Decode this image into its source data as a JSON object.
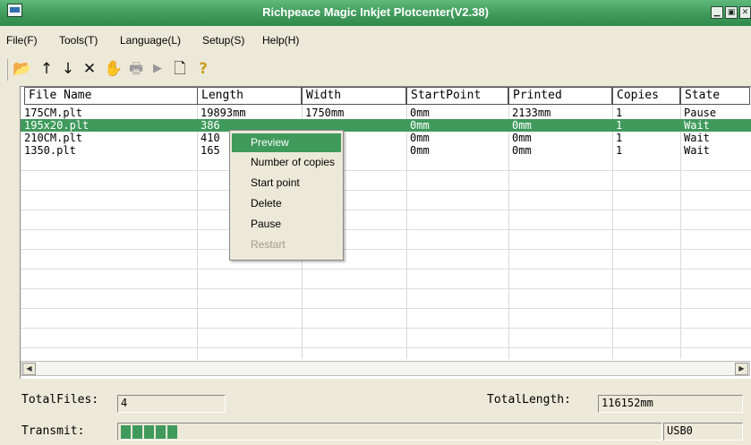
{
  "window": {
    "title": "Richpeace Magic Inkjet Plotcenter(V2.38)",
    "controls": {
      "minimize": "▁",
      "maximize": "▣",
      "close": "✕"
    }
  },
  "menu": [
    {
      "label": "File(F)"
    },
    {
      "label": "Tools(T)"
    },
    {
      "label": "Language(L)"
    },
    {
      "label": "Setup(S)"
    },
    {
      "label": "Help(H)"
    }
  ],
  "toolbar": [
    {
      "icon": "open-folder-icon",
      "glyph": "📂"
    },
    {
      "icon": "move-up-icon",
      "glyph": "↑"
    },
    {
      "icon": "move-down-icon",
      "glyph": "↓"
    },
    {
      "icon": "delete-icon",
      "glyph": "✕"
    },
    {
      "icon": "hand-icon",
      "glyph": "✋"
    },
    {
      "icon": "printer-icon",
      "glyph": "🖶"
    },
    {
      "icon": "play-icon",
      "glyph": "▶"
    },
    {
      "icon": "print-preview-icon",
      "glyph": "🗋"
    },
    {
      "icon": "help-icon",
      "glyph": "?"
    }
  ],
  "table": {
    "columns": [
      "File Name",
      "Length",
      "Width",
      "StartPoint",
      "Printed",
      "Copies",
      "State"
    ],
    "rows": [
      [
        "175CM.plt",
        "19893mm",
        "1750mm",
        "0mm",
        "2133mm",
        "1",
        "Pause"
      ],
      [
        "195x20.plt",
        "386",
        "",
        "0mm",
        "0mm",
        "1",
        "Wait"
      ],
      [
        "210CM.plt",
        "410",
        "",
        "0mm",
        "0mm",
        "1",
        "Wait"
      ],
      [
        "1350.plt",
        "165",
        "",
        "0mm",
        "0mm",
        "1",
        "Wait"
      ]
    ],
    "selected_row": 1,
    "colors": {
      "selection": "#3f9a5c"
    }
  },
  "context_menu": {
    "items": [
      {
        "label": "Preview",
        "highlighted": true,
        "disabled": false
      },
      {
        "label": "Number of copies",
        "highlighted": false,
        "disabled": false
      },
      {
        "label": "Start point",
        "highlighted": false,
        "disabled": false
      },
      {
        "label": "Delete",
        "highlighted": false,
        "disabled": false
      },
      {
        "label": "Pause",
        "highlighted": false,
        "disabled": false
      },
      {
        "label": "Restart",
        "highlighted": false,
        "disabled": true
      }
    ]
  },
  "status": {
    "total_files_label": "TotalFiles:",
    "total_files_value": "4",
    "total_length_label": "TotalLength:",
    "total_length_value": "116152mm",
    "transmit_label": "Transmit:",
    "transmit_blocks": 5,
    "port": "USB0"
  },
  "scrollbar": {
    "left": "◀",
    "right": "▶"
  }
}
